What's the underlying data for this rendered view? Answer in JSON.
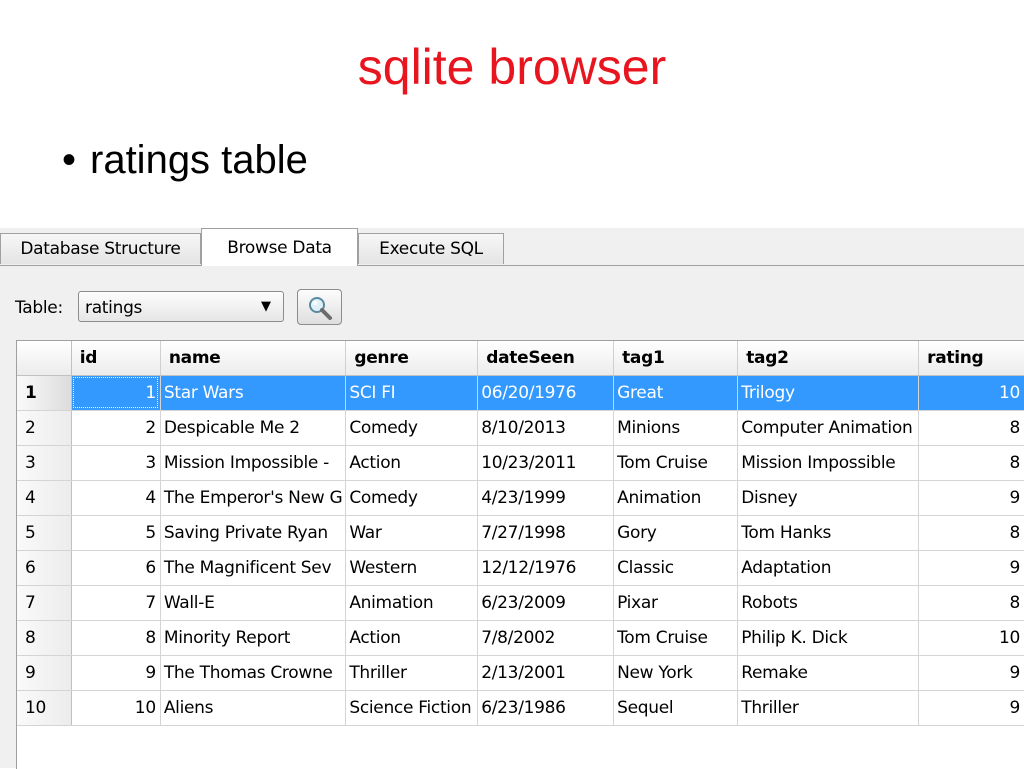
{
  "slide": {
    "title": "sqlite browser",
    "bullet_symbol": "•",
    "bullet": "ratings table",
    "title_color": "#e8141e"
  },
  "tabs": [
    {
      "label": "Database Structure",
      "active": false
    },
    {
      "label": "Browse Data",
      "active": true
    },
    {
      "label": "Execute SQL",
      "active": false
    }
  ],
  "toolbar": {
    "table_label": "Table:",
    "table_select_value": "ratings",
    "dropdown_icon": "triangle-down-icon",
    "search_icon": "magnifier-icon"
  },
  "grid": {
    "selection_color": "#3399ff",
    "columns": [
      "id",
      "name",
      "genre",
      "dateSeen",
      "tag1",
      "tag2",
      "rating"
    ],
    "rows": [
      {
        "row": "1",
        "id": "1",
        "name": "Star Wars",
        "genre": "SCI FI",
        "dateSeen": "06/20/1976",
        "tag1": "Great",
        "tag2": "Trilogy",
        "rating": "10"
      },
      {
        "row": "2",
        "id": "2",
        "name": "Despicable Me 2",
        "genre": "Comedy",
        "dateSeen": "8/10/2013",
        "tag1": "Minions",
        "tag2": "Computer Animation",
        "rating": "8"
      },
      {
        "row": "3",
        "id": "3",
        "name": "Mission Impossible -",
        "genre": "Action",
        "dateSeen": "10/23/2011",
        "tag1": "Tom Cruise",
        "tag2": "Mission Impossible",
        "rating": "8"
      },
      {
        "row": "4",
        "id": "4",
        "name": "The Emperor's New G",
        "genre": "Comedy",
        "dateSeen": "4/23/1999",
        "tag1": "Animation",
        "tag2": "Disney",
        "rating": "9"
      },
      {
        "row": "5",
        "id": "5",
        "name": "Saving Private Ryan",
        "genre": "War",
        "dateSeen": "7/27/1998",
        "tag1": "Gory",
        "tag2": "Tom Hanks",
        "rating": "8"
      },
      {
        "row": "6",
        "id": "6",
        "name": "The Magnificent Sev",
        "genre": "Western",
        "dateSeen": "12/12/1976",
        "tag1": "Classic",
        "tag2": "Adaptation",
        "rating": "9"
      },
      {
        "row": "7",
        "id": "7",
        "name": "Wall-E",
        "genre": "Animation",
        "dateSeen": "6/23/2009",
        "tag1": "Pixar",
        "tag2": "Robots",
        "rating": "8"
      },
      {
        "row": "8",
        "id": "8",
        "name": "Minority Report",
        "genre": "Action",
        "dateSeen": "7/8/2002",
        "tag1": "Tom Cruise",
        "tag2": "Philip K. Dick",
        "rating": "10"
      },
      {
        "row": "9",
        "id": "9",
        "name": "The Thomas Crowne",
        "genre": "Thriller",
        "dateSeen": "2/13/2001",
        "tag1": "New York",
        "tag2": "Remake",
        "rating": "9"
      },
      {
        "row": "10",
        "id": "10",
        "name": "Aliens",
        "genre": "Science Fiction",
        "dateSeen": "6/23/1986",
        "tag1": "Sequel",
        "tag2": "Thriller",
        "rating": "9"
      }
    ],
    "selected_row": 0
  }
}
